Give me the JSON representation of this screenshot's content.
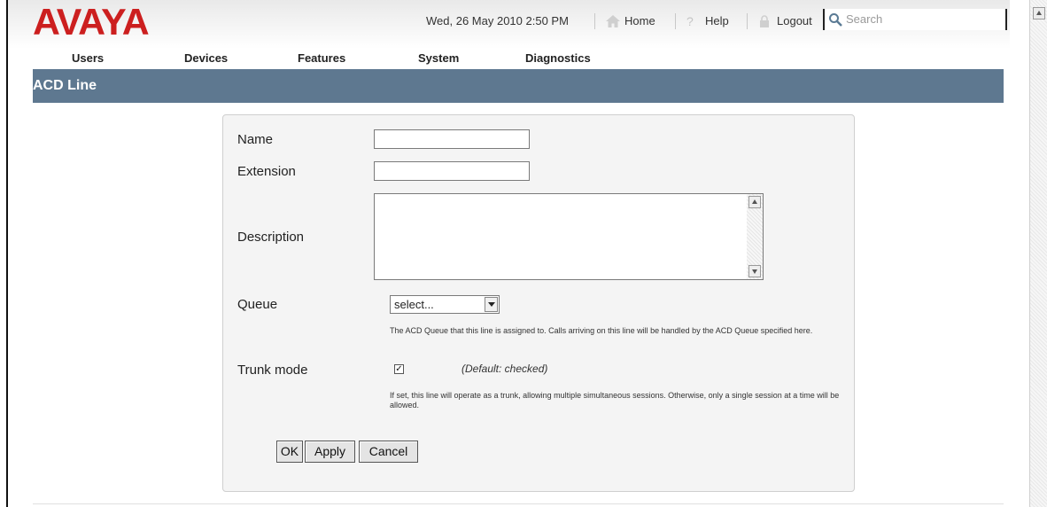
{
  "header": {
    "logo_text": "AVAYA",
    "datetime": "Wed, 26 May 2010 2:50 PM",
    "home_label": "Home",
    "help_label": "Help",
    "logout_label": "Logout",
    "search_placeholder": "Search",
    "brand_color": "#cc1f1f"
  },
  "nav": {
    "items": [
      {
        "label": "Users"
      },
      {
        "label": "Devices"
      },
      {
        "label": "Features"
      },
      {
        "label": "System"
      },
      {
        "label": "Diagnostics"
      }
    ]
  },
  "page": {
    "title": "ACD Line",
    "title_bar_color": "#5e7890"
  },
  "form": {
    "name_label": "Name",
    "name_value": "",
    "extension_label": "Extension",
    "extension_value": "",
    "description_label": "Description",
    "description_value": "",
    "queue_label": "Queue",
    "queue_selected": "select...",
    "queue_help": "The ACD Queue that this line is assigned to. Calls arriving on this line will be handled by the ACD Queue specified here.",
    "trunk_label": "Trunk mode",
    "trunk_checked": true,
    "trunk_default": "(Default: checked)",
    "trunk_help": "If set, this line will operate as a trunk, allowing multiple simultaneous sessions. Otherwise, only a single session at a time will be allowed.",
    "buttons": {
      "ok": "OK",
      "apply": "Apply",
      "cancel": "Cancel"
    }
  }
}
